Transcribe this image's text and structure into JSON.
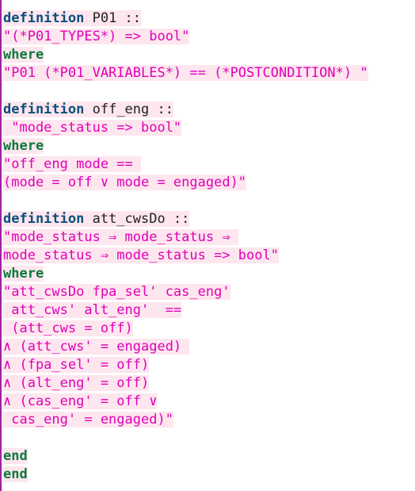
{
  "editor": {
    "colors": {
      "keyword_definition": "#0b4f7a",
      "keyword_where_end": "#0b7a3a",
      "string": "#e000b8",
      "highlight_background": "#fde6ee",
      "gutter": "#a020a0",
      "text": "#222222"
    },
    "lines": [
      {
        "kw": "definition",
        "rest": " P01 ::",
        "hl": true
      },
      {
        "str": "\"(*P01_TYPES*) => bool\"",
        "hl": true
      },
      {
        "kw2": "where",
        "hl": true
      },
      {
        "str": "\"P01 (*P01_VARIABLES*) == (*POSTCONDITION*) \"",
        "hl": true
      },
      {
        "blank": true
      },
      {
        "kw": "definition",
        "rest": " off_eng ::",
        "hl": true
      },
      {
        "str": " \"mode_status => bool\"",
        "hl": true
      },
      {
        "kw2": "where",
        "hl": true
      },
      {
        "str": "\"off_eng mode == ",
        "hl": true
      },
      {
        "str": "(mode = off ∨ mode = engaged)\"",
        "hl": true
      },
      {
        "blank": true
      },
      {
        "kw": "definition",
        "rest": " att_cwsDo ::",
        "hl": true
      },
      {
        "str": "\"mode_status ⇒ mode_status ⇒ ",
        "hl": true
      },
      {
        "str": "mode_status ⇒ mode_status => bool\"",
        "hl": true
      },
      {
        "kw2": "where",
        "hl": true
      },
      {
        "str": "\"att_cwsDo fpa_sel' cas_eng'",
        "hl": true
      },
      {
        "str": " att_cws' alt_eng'  ==",
        "hl": true
      },
      {
        "str": " (att_cws = off)",
        "hl": true
      },
      {
        "str": "∧ (att_cws' = engaged) ",
        "hl": true
      },
      {
        "str": "∧ (fpa_sel' = off)",
        "hl": true
      },
      {
        "str": "∧ (alt_eng' = off)",
        "hl": true
      },
      {
        "str": "∧ (cas_eng' = off ∨",
        "hl": true
      },
      {
        "str": " cas_eng' = engaged)\"",
        "hl": true
      },
      {
        "blank": true
      },
      {
        "kw2": "end",
        "hl": true
      },
      {
        "kw2": "end",
        "hl": true
      }
    ]
  }
}
